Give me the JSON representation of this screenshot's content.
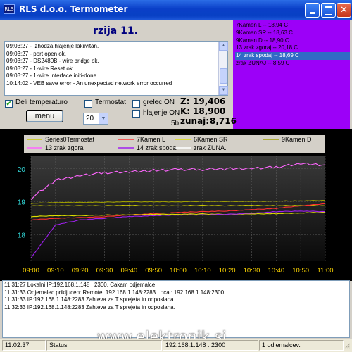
{
  "window": {
    "title": "RLS d.o.o. Termometer",
    "icon_text": "RLS"
  },
  "header": {
    "title": "rzija 11."
  },
  "log_lines": [
    "09:03:27 - Izhodza hlajenje lakiivitan.",
    "09:03:27 - port open ok.",
    "09:03:27 - DS2480B - wire bridge ok.",
    "09:03:27 - 1-wire Reset ok.",
    "09:03:27 - 1-wire Interface initi-done.",
    "10:14:02 - VEB save error - An unexpected network error occurred"
  ],
  "sensor_list": [
    {
      "text": "7Kamen L -- 18,94 C",
      "selected": false
    },
    {
      "text": "9Kamen SR -- 18,63 C",
      "selected": false
    },
    {
      "text": "9Kamen D -- 18,90 C",
      "selected": false
    },
    {
      "text": "13 zrak zgoraj -- 20,18 C",
      "selected": false
    },
    {
      "text": "14 zrak spodaj -- 18,69 C",
      "selected": true
    },
    {
      "text": "zrak ZUNAJ -- 8,59 C",
      "selected": false
    }
  ],
  "controls": {
    "deli_temperature": {
      "label": "Deli temperaturo",
      "checked": true
    },
    "termostat": {
      "label": "Termostat",
      "checked": false
    },
    "grelec": {
      "label": "grelec ON",
      "checked": false
    },
    "hlajenje": {
      "label": "hlajenje ON",
      "checked": false
    },
    "menu_label": "menu",
    "interval_value": "20",
    "sensor_no": "5b"
  },
  "readouts": {
    "z_label": "Z:",
    "z_value": "19,406",
    "k_label": "K:",
    "k_value": "18,900",
    "zunaj_label": "zunaj:",
    "zunaj_value": "8,716"
  },
  "chart_data": {
    "type": "line",
    "x": [
      "09:00",
      "09:10",
      "09:20",
      "09:30",
      "09:40",
      "09:50",
      "10:00",
      "10:10",
      "10:20",
      "10:30",
      "10:40",
      "10:50",
      "11:00"
    ],
    "yticks": [
      18,
      19,
      20
    ],
    "ylim": [
      17.2,
      20.4
    ],
    "grid": true,
    "legend_position": "top",
    "series": [
      {
        "name": "Series0Termostat",
        "color": "#c8c800",
        "values": [
          18.88,
          18.88,
          18.88,
          18.88,
          18.89,
          18.88,
          18.88,
          18.89,
          18.88,
          18.89,
          18.88,
          18.89,
          18.88
        ]
      },
      {
        "name": "7Kamen L",
        "color": "#ff3030",
        "values": [
          18.45,
          18.5,
          18.52,
          18.55,
          18.6,
          18.64,
          18.68,
          18.7,
          18.72,
          18.76,
          18.8,
          18.88,
          18.94
        ]
      },
      {
        "name": "6Kamen SR",
        "color": "#e0e000",
        "values": [
          18.55,
          18.58,
          18.58,
          18.6,
          18.6,
          18.62,
          18.62,
          18.63,
          18.62,
          18.63,
          18.64,
          18.66,
          18.68
        ]
      },
      {
        "name": "9Kamen D",
        "color": "#a0a000",
        "values": [
          18.95,
          18.98,
          18.98,
          18.99,
          19.0,
          19.0,
          19.0,
          19.01,
          19.01,
          19.01,
          19.02,
          19.03,
          19.04
        ]
      },
      {
        "name": "13 zrak zgoraj",
        "color": "#ff66ff",
        "values": [
          19.1,
          19.65,
          19.8,
          19.88,
          19.9,
          19.95,
          19.98,
          19.98,
          20.0,
          20.02,
          20.05,
          20.15,
          20.12
        ]
      },
      {
        "name": "14 zrak spodaj",
        "color": "#a020f0",
        "values": [
          17.3,
          18.3,
          18.45,
          18.5,
          18.55,
          18.58,
          18.6,
          18.6,
          18.62,
          18.65,
          18.7,
          18.72,
          18.7
        ]
      },
      {
        "name": "zrak ZUNA.",
        "color": "#ffffff",
        "values": []
      }
    ]
  },
  "lower_log": [
    "11:31:27 Lokalni IP:192.168.1.148 : 2300. Cakam odjemalce.",
    "11:31:33 Odjemalec prikljucen: Remote: 192.168.1.148:2283 Local: 192.168.1.148:2300",
    "11:31:33 IP:192.168.1.148:2283 Zahteva za T sprejeta in odposlana.",
    "11:32:33 IP:192.168.1.148:2283 Zahteva za T sprejeta in odposlana."
  ],
  "statusbar": {
    "time": "11:02:37",
    "status": "Status",
    "ip": "192.168.1.148 : 2300",
    "clients": "1 odjemalcev."
  },
  "watermark": "www.elektronik.si"
}
